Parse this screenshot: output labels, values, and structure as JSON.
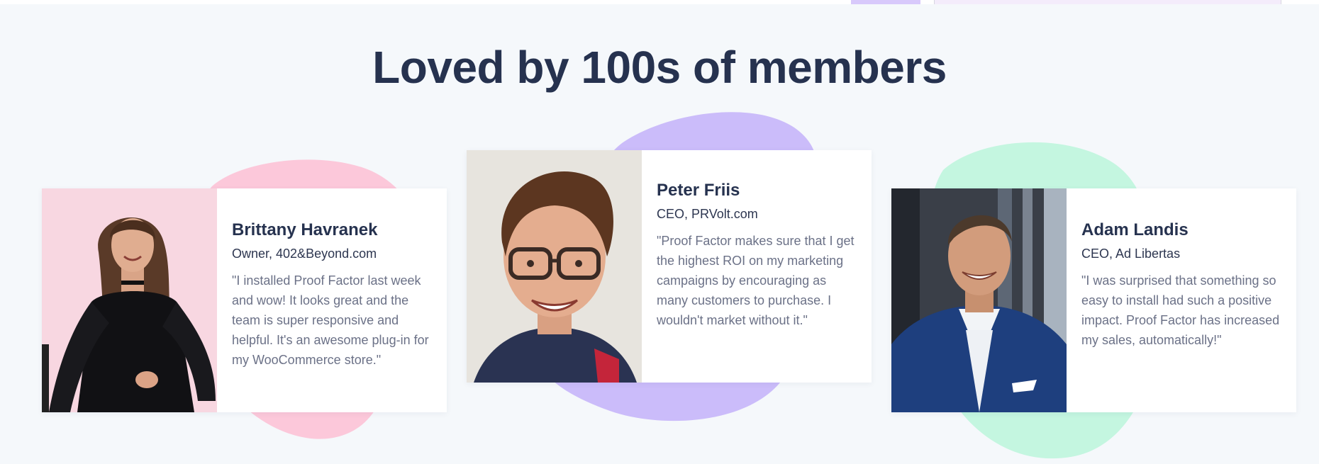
{
  "section": {
    "title": "Loved by 100s of members"
  },
  "colors": {
    "background": "#f5f8fb",
    "heading": "#26324f",
    "quote_text": "#6b7187",
    "blob_pink": "#fcc8da",
    "blob_purple": "#cbbcfa",
    "blob_mint": "#c4f6e0"
  },
  "testimonials": [
    {
      "name": "Brittany Havranek",
      "role": "Owner, 402&Beyond.com",
      "quote": "\"I installed Proof Factor last week and wow! It looks great and the team is super responsive and helpful. It's an awesome plug-in for my WooCommerce store.\"",
      "photo": "woman-in-black-dress-portrait"
    },
    {
      "name": "Peter Friis",
      "role": "CEO, PRVolt.com",
      "quote": "\"Proof Factor makes sure that I get the highest ROI on my marketing campaigns by encouraging as many customers to purchase. I wouldn't market without it.\"",
      "photo": "man-with-glasses-portrait"
    },
    {
      "name": "Adam Landis",
      "role": "CEO, Ad Libertas",
      "quote": "\"I was surprised that something so easy to install had such a positive impact. Proof Factor has increased my sales, automatically!\"",
      "photo": "man-in-blue-suit-portrait"
    }
  ]
}
